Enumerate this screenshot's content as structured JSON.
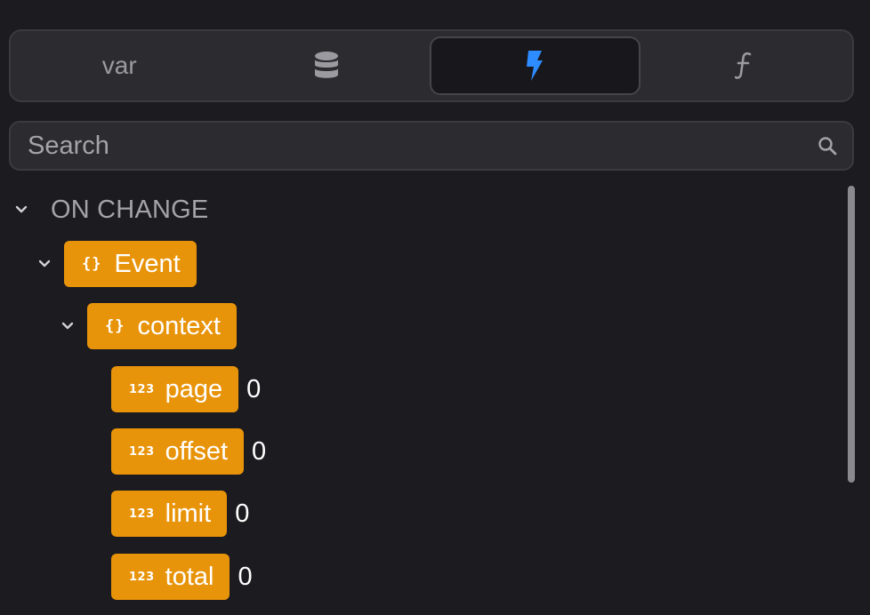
{
  "tabs": [
    {
      "label": "var",
      "icon": "",
      "active": false
    },
    {
      "label": "",
      "icon": "database-icon",
      "active": false
    },
    {
      "label": "",
      "icon": "lightning-bolt-icon",
      "active": true
    },
    {
      "label": "",
      "icon": "function-icon",
      "active": false
    }
  ],
  "search": {
    "placeholder": "Search",
    "value": ""
  },
  "tree": {
    "section": "ON CHANGE",
    "event": {
      "label": "Event",
      "type_glyph": "{}"
    },
    "context": {
      "label": "context",
      "type_glyph": "{}"
    },
    "fields": [
      {
        "label": "page",
        "type_glyph": "123",
        "value": "0"
      },
      {
        "label": "offset",
        "type_glyph": "123",
        "value": "0"
      },
      {
        "label": "limit",
        "type_glyph": "123",
        "value": "0"
      },
      {
        "label": "total",
        "type_glyph": "123",
        "value": "0"
      }
    ]
  },
  "colors": {
    "background": "#1c1b1f",
    "panel": "#2c2c30",
    "pill": "#e8940a",
    "accent_blue": "#2d8cff",
    "muted_text": "#a3a3a8"
  }
}
